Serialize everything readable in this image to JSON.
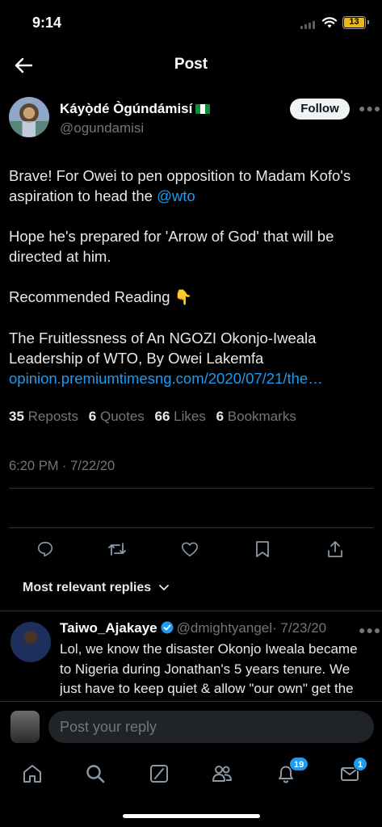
{
  "status_bar": {
    "time": "9:14",
    "battery": "13",
    "battery_color": "#e8b81e"
  },
  "header": {
    "title": "Post",
    "back_icon": "arrow-left-icon"
  },
  "tweet": {
    "author_name": "Káyọ̀dé Ògúndámisí",
    "author_flag": "nigeria-flag-icon",
    "author_handle": "@ogundamisi",
    "follow_label": "Follow",
    "paragraph1": "Brave! For Owei to pen opposition to Madam Kofo's aspiration to head the ",
    "mention": "@wto",
    "paragraph2": "Hope he's prepared for 'Arrow of God' that will be directed at him.",
    "paragraph3": "Recommended Reading ",
    "paragraph3_emoji": "👇",
    "paragraph4": "The Fruitlessness of An NGOZI Okonjo-Iweala Leadership of WTO, By Owei Lakemfa",
    "link_text": "opinion.premiumtimesng.com/2020/07/21/the…",
    "timestamp": "6:20 PM · 7/22/20"
  },
  "stats": {
    "reposts_count": "35",
    "reposts_label": "Reposts",
    "quotes_count": "6",
    "quotes_label": "Quotes",
    "likes_count": "66",
    "likes_label": "Likes",
    "bookmarks_count": "6",
    "bookmarks_label": "Bookmarks"
  },
  "actions": [
    "reply-icon",
    "repost-icon",
    "like-icon",
    "bookmark-icon",
    "share-icon"
  ],
  "replies_filter": {
    "label": "Most relevant replies",
    "icon": "chevron-down-icon"
  },
  "reply": {
    "name": "Taiwo_Ajakaye",
    "handle": "@dmightyangel",
    "date": "· 7/23/20",
    "text": "Lol, we know the disaster Okonjo Iweala became to Nigeria during Jonathan's 5 years tenure. We just have to keep quiet & allow \"our own\" get the position at WTO. We don't need"
  },
  "composer": {
    "placeholder": "Post your reply"
  },
  "tabbar": {
    "tabs": [
      "home-icon",
      "search-icon",
      "grok-icon",
      "communities-icon",
      "notifications-icon",
      "messages-icon"
    ],
    "notifications_badge": "19",
    "messages_badge": "1",
    "accent": "#1d9bf0"
  }
}
